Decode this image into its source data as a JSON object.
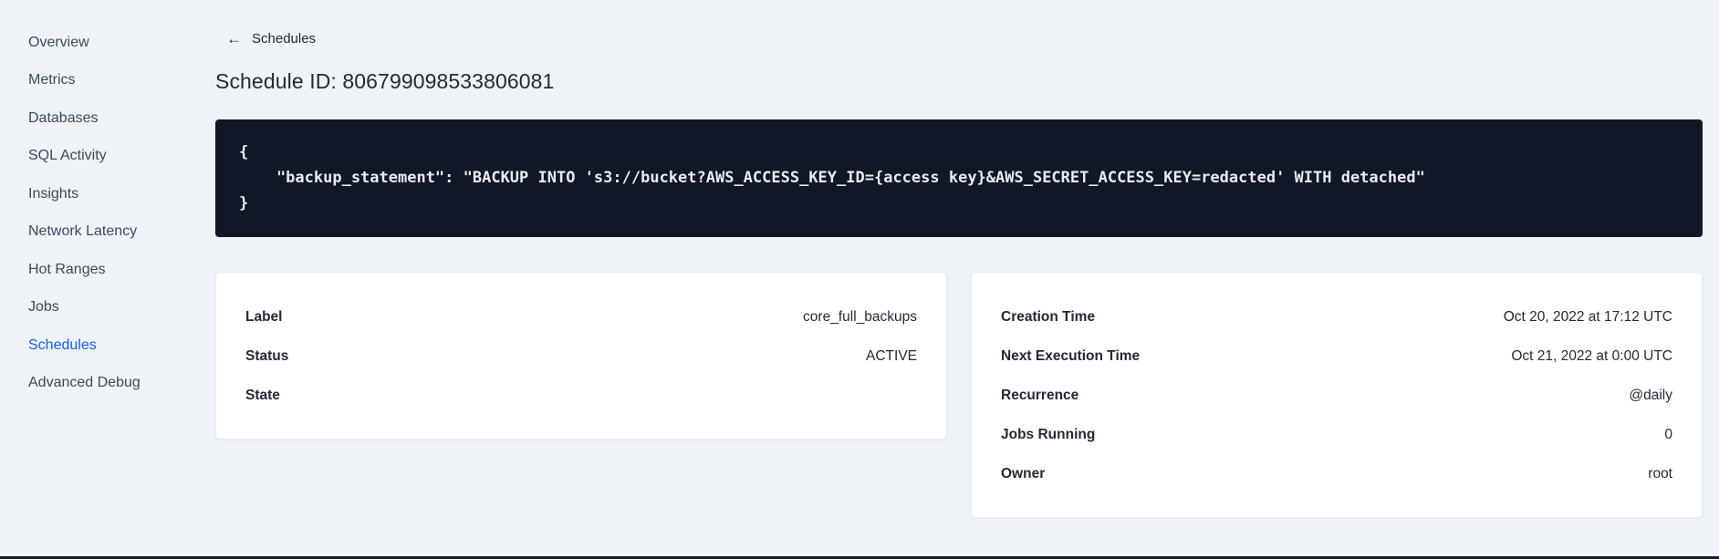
{
  "sidebar": {
    "items": [
      {
        "label": "Overview",
        "active": false
      },
      {
        "label": "Metrics",
        "active": false
      },
      {
        "label": "Databases",
        "active": false
      },
      {
        "label": "SQL Activity",
        "active": false
      },
      {
        "label": "Insights",
        "active": false
      },
      {
        "label": "Network Latency",
        "active": false
      },
      {
        "label": "Hot Ranges",
        "active": false
      },
      {
        "label": "Jobs",
        "active": false
      },
      {
        "label": "Schedules",
        "active": true
      },
      {
        "label": "Advanced Debug",
        "active": false
      }
    ]
  },
  "main": {
    "back_link": {
      "arrow": "←",
      "label": "Schedules"
    },
    "page_title": "Schedule ID: 806799098533806081",
    "code_block": {
      "text": "{\n    \"backup_statement\": \"BACKUP INTO 's3://bucket?AWS_ACCESS_KEY_ID={access key}&AWS_SECRET_ACCESS_KEY=redacted' WITH detached\"\n}"
    },
    "schedule_card": {
      "rows": [
        {
          "label": "Label",
          "value": "core_full_backups"
        },
        {
          "label": "Status",
          "value": "ACTIVE"
        },
        {
          "label": "State",
          "value": ""
        }
      ]
    },
    "details_card": {
      "rows": [
        {
          "label": "Creation Time",
          "value": "Oct 20, 2022 at 17:12 UTC"
        },
        {
          "label": "Next Execution Time",
          "value": "Oct 21, 2022 at 0:00 UTC"
        },
        {
          "label": "Recurrence",
          "value": "@daily"
        },
        {
          "label": "Jobs Running",
          "value": "0"
        },
        {
          "label": "Owner",
          "value": "root"
        }
      ]
    }
  },
  "colors": {
    "page_background": "#eff3f8",
    "active_nav_blue": "#1a5cf5",
    "code_block_background": "#111726",
    "code_text": "#e7ebf2",
    "text_dark": "#242a35",
    "card_background": "#ffffff"
  }
}
